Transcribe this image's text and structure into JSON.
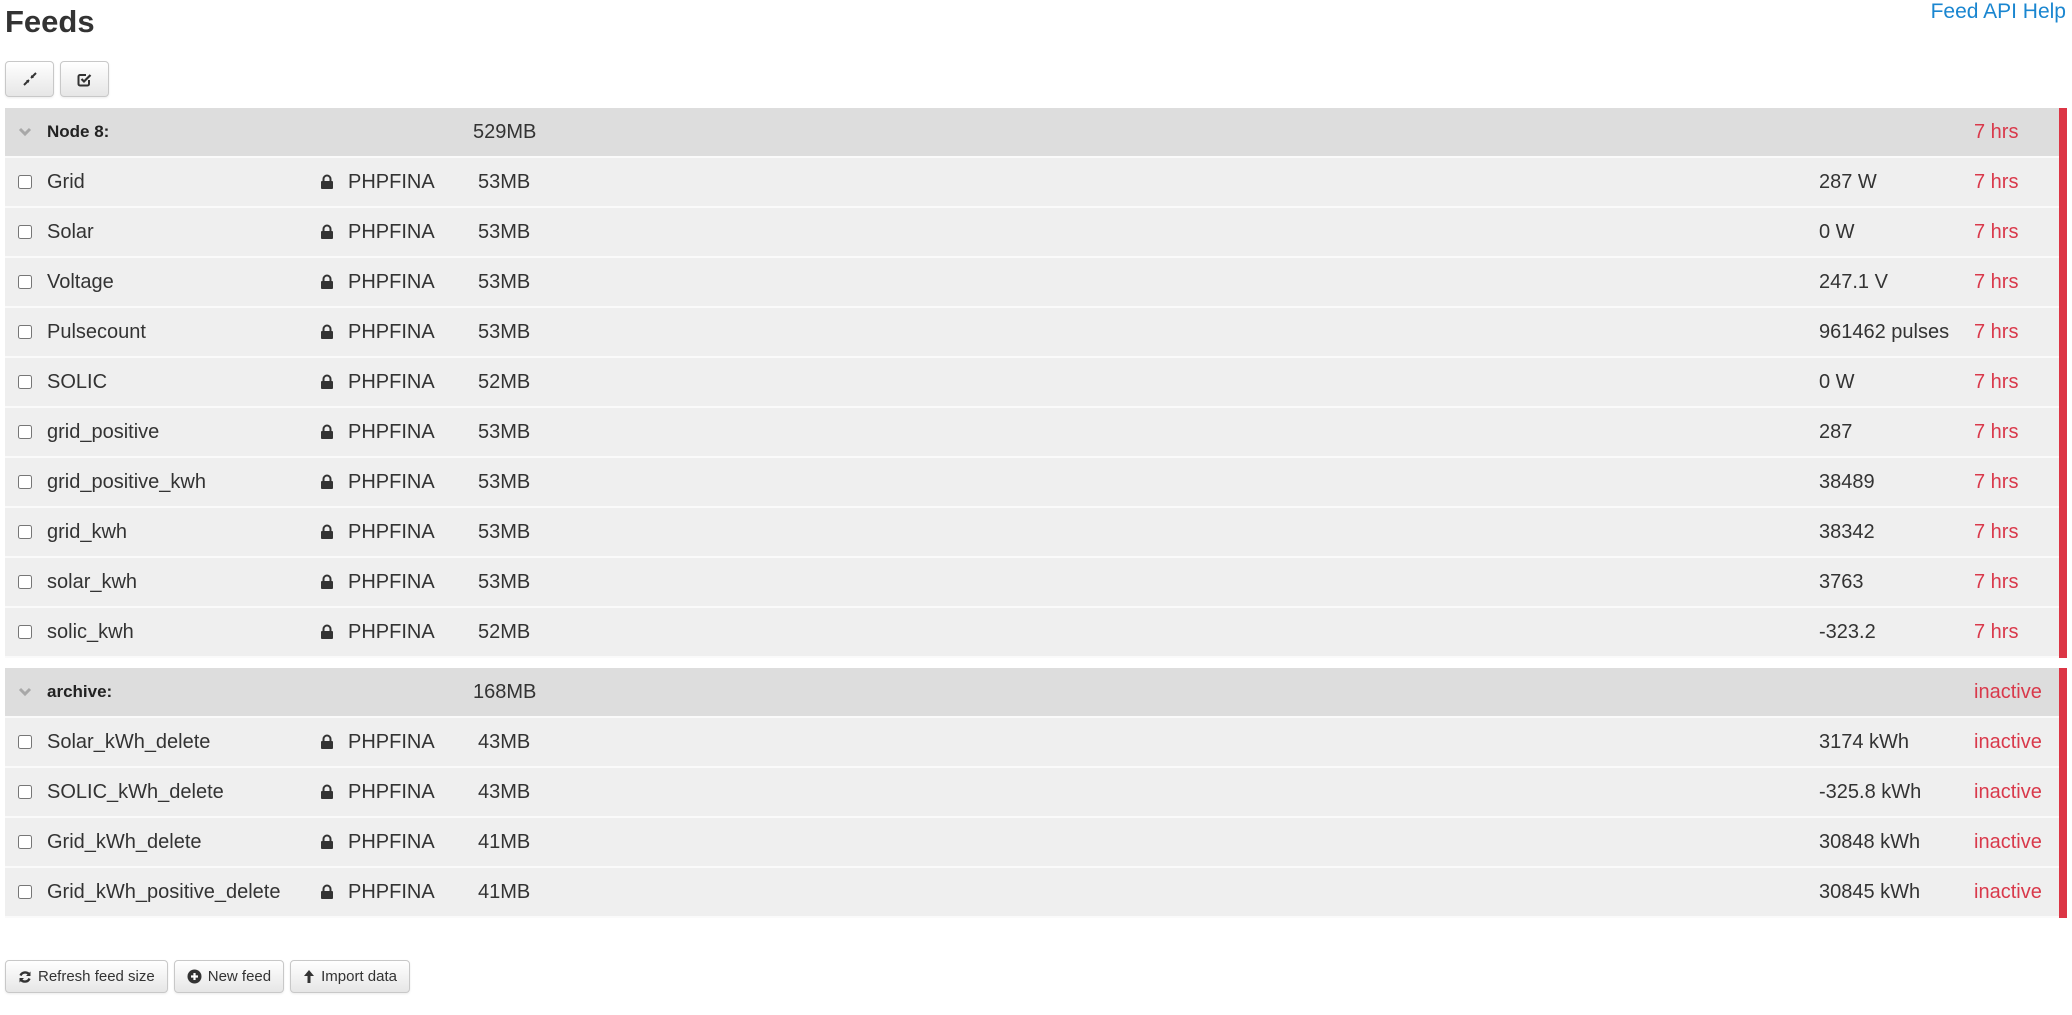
{
  "page": {
    "title": "Feeds",
    "api_help_link": "Feed API Help"
  },
  "toolbar": {
    "collapse_all_icon": "compress-icon",
    "select_all_icon": "check-square-icon"
  },
  "colors": {
    "accent_link": "#1a86d0",
    "status_red": "#dc3545",
    "group_header_bg": "#dddddd",
    "row_bg": "#efefef"
  },
  "groups": [
    {
      "name": "Node 8:",
      "size": "529MB",
      "time": "7 hrs",
      "feeds": [
        {
          "name": "Grid",
          "engine": "PHPFINA",
          "size": "53MB",
          "value": "287 W",
          "time": "7 hrs"
        },
        {
          "name": "Solar",
          "engine": "PHPFINA",
          "size": "53MB",
          "value": "0 W",
          "time": "7 hrs"
        },
        {
          "name": "Voltage",
          "engine": "PHPFINA",
          "size": "53MB",
          "value": "247.1 V",
          "time": "7 hrs"
        },
        {
          "name": "Pulsecount",
          "engine": "PHPFINA",
          "size": "53MB",
          "value": "961462 pulses",
          "time": "7 hrs"
        },
        {
          "name": "SOLIC",
          "engine": "PHPFINA",
          "size": "52MB",
          "value": "0 W",
          "time": "7 hrs"
        },
        {
          "name": "grid_positive",
          "engine": "PHPFINA",
          "size": "53MB",
          "value": "287",
          "time": "7 hrs"
        },
        {
          "name": "grid_positive_kwh",
          "engine": "PHPFINA",
          "size": "53MB",
          "value": "38489",
          "time": "7 hrs"
        },
        {
          "name": "grid_kwh",
          "engine": "PHPFINA",
          "size": "53MB",
          "value": "38342",
          "time": "7 hrs"
        },
        {
          "name": "solar_kwh",
          "engine": "PHPFINA",
          "size": "53MB",
          "value": "3763",
          "time": "7 hrs"
        },
        {
          "name": "solic_kwh",
          "engine": "PHPFINA",
          "size": "52MB",
          "value": "-323.2",
          "time": "7 hrs"
        }
      ]
    },
    {
      "name": "archive:",
      "size": "168MB",
      "time": "inactive",
      "feeds": [
        {
          "name": "Solar_kWh_delete",
          "engine": "PHPFINA",
          "size": "43MB",
          "value": "3174 kWh",
          "time": "inactive"
        },
        {
          "name": "SOLIC_kWh_delete",
          "engine": "PHPFINA",
          "size": "43MB",
          "value": "-325.8 kWh",
          "time": "inactive"
        },
        {
          "name": "Grid_kWh_delete",
          "engine": "PHPFINA",
          "size": "41MB",
          "value": "30848 kWh",
          "time": "inactive"
        },
        {
          "name": "Grid_kWh_positive_delete",
          "engine": "PHPFINA",
          "size": "41MB",
          "value": "30845 kWh",
          "time": "inactive"
        }
      ]
    }
  ],
  "bottom_buttons": {
    "refresh_label": "Refresh feed size",
    "new_feed_label": "New feed",
    "import_label": "Import data"
  }
}
